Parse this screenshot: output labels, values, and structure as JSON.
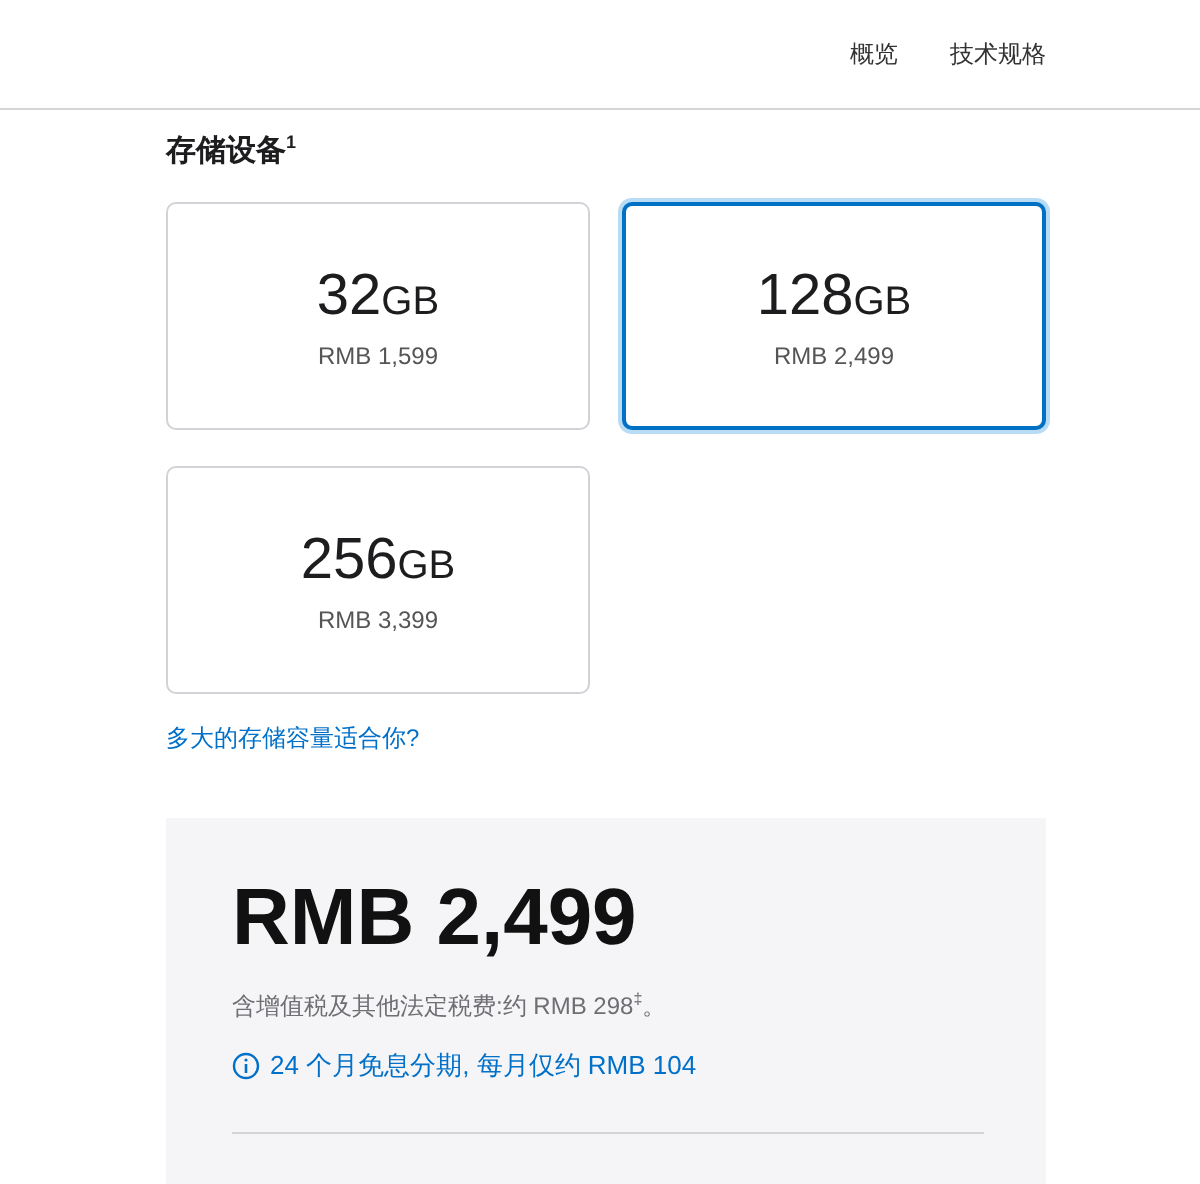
{
  "nav": {
    "links": [
      "概览",
      "技术规格"
    ]
  },
  "storage": {
    "heading": "存储设备$^{1}$",
    "options": [
      {
        "capacity": "32",
        "unit": "GB",
        "price": "RMB 1,599",
        "selected": false
      },
      {
        "capacity": "128",
        "unit": "GB",
        "price": "RMB 2,499",
        "selected": true
      },
      {
        "capacity": "256",
        "unit": "GB",
        "price": "RMB 3,399",
        "selected": false
      }
    ],
    "help_link": "多大的存储容量适合你?"
  },
  "summary": {
    "price": "RMB 2,499",
    "tax_note": "含增值税及其他法定税费:约 RMB 298$^{‡}$。",
    "installment": "24 个月免息分期, 每月仅约 RMB 104"
  }
}
